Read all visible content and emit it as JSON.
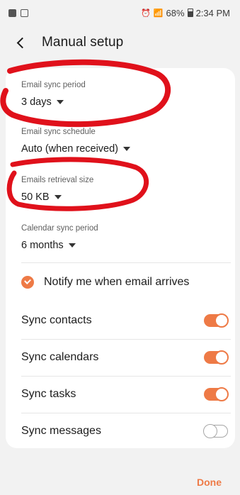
{
  "status_bar": {
    "battery": "68%",
    "time": "2:34 PM"
  },
  "header": {
    "title": "Manual setup"
  },
  "fields": {
    "email_sync_period": {
      "label": "Email sync period",
      "value": "3 days"
    },
    "email_sync_schedule": {
      "label": "Email sync schedule",
      "value": "Auto (when received)"
    },
    "emails_retrieval_size": {
      "label": "Emails retrieval size",
      "value": "50 KB"
    },
    "calendar_sync_period": {
      "label": "Calendar sync period",
      "value": "6 months"
    }
  },
  "notify": {
    "label": "Notify me when email arrives",
    "checked": true
  },
  "toggles": [
    {
      "label": "Sync contacts",
      "on": true
    },
    {
      "label": "Sync calendars",
      "on": true
    },
    {
      "label": "Sync tasks",
      "on": true
    },
    {
      "label": "Sync messages",
      "on": false
    }
  ],
  "footer": {
    "done_label": "Done"
  },
  "colors": {
    "accent": "#ee7a46",
    "annotation": "#e0111b",
    "background": "#f2f2f2"
  }
}
